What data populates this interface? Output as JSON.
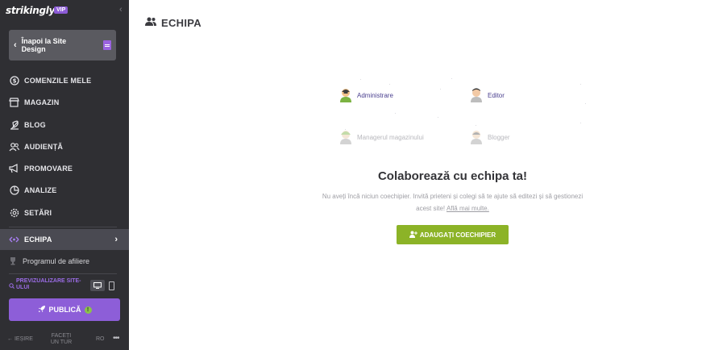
{
  "brand": {
    "logo": "strikingly",
    "badge": "VIP"
  },
  "sidebar": {
    "back_label": "Înapoi la Site Design",
    "items": [
      {
        "label": "COMENZILE MELE",
        "icon": "dollar-circle-icon"
      },
      {
        "label": "MAGAZIN",
        "icon": "store-icon"
      },
      {
        "label": "BLOG",
        "icon": "feather-icon"
      },
      {
        "label": "AUDIENȚĂ",
        "icon": "users-icon"
      },
      {
        "label": "PROMOVARE",
        "icon": "megaphone-icon"
      },
      {
        "label": "ANALIZE",
        "icon": "pie-chart-icon"
      },
      {
        "label": "SETĂRI",
        "icon": "gear-icon"
      },
      {
        "label": "ECHIPA",
        "icon": "team-icon",
        "active": true
      }
    ],
    "affiliate_label": "Programul de afiliere",
    "preview_label": "PREVIZUALIZARE SITE-ULUI",
    "publish_label": "PUBLICĂ",
    "publish_badge": "!",
    "footer": {
      "exit": "IEȘIRE",
      "tour": "FACEȚI UN TUR",
      "lang": "RO",
      "more": "•••"
    }
  },
  "main": {
    "title": "ECHIPA",
    "roles": [
      {
        "label": "Administrare",
        "state": "on"
      },
      {
        "label": "Editor",
        "state": "on"
      },
      {
        "label": "Managerul magazinului",
        "state": "off"
      },
      {
        "label": "Blogger",
        "state": "off"
      }
    ],
    "empty_title": "Colaborează cu echipa ta!",
    "empty_desc": "Nu aveți încă niciun coechipier. Invită prieteni și colegi să te ajute să editezi și să gestionezi acest site!",
    "learn_more": "Află mai multe.",
    "add_button": "ADAUGAȚI COECHIPIER"
  },
  "colors": {
    "sidebar_bg": "#2f2f33",
    "accent_purple": "#8d5ed8",
    "add_green": "#8cb327"
  }
}
